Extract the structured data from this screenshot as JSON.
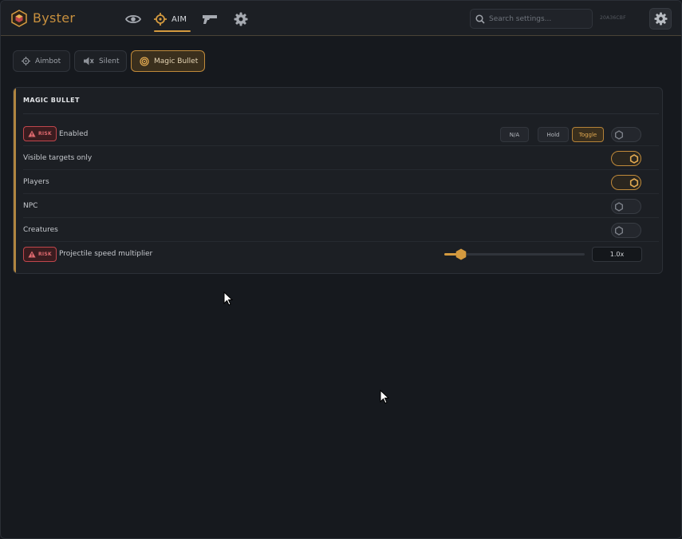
{
  "app": {
    "brand": "Byster",
    "hwid": "20A36CBF",
    "accent_color": "#d49a3f",
    "risk_color": "#c0464c"
  },
  "nav": {
    "items": [
      {
        "icon": "eye-icon",
        "label": ""
      },
      {
        "icon": "crosshair-icon",
        "label": "AIM",
        "active": true
      },
      {
        "icon": "gun-icon",
        "label": ""
      },
      {
        "icon": "gear-icon",
        "label": ""
      }
    ]
  },
  "search": {
    "placeholder": "Search settings...",
    "value": ""
  },
  "subtabs": [
    {
      "icon": "crosshair-icon",
      "label": "Aimbot",
      "active": false
    },
    {
      "icon": "mute-icon",
      "label": "Silent",
      "active": false
    },
    {
      "icon": "target-icon",
      "label": "Magic Bullet",
      "active": true
    }
  ],
  "panel": {
    "title": "MAGIC BULLET",
    "risk_label": "RISK",
    "rows": [
      {
        "label": "Enabled",
        "risk": true,
        "type": "toggle-keybind",
        "keybind": "N/A",
        "modes": [
          "Hold",
          "Toggle"
        ],
        "active_mode": "Toggle",
        "on": false
      },
      {
        "label": "Visible targets only",
        "risk": false,
        "type": "toggle",
        "on": true
      },
      {
        "label": "Players",
        "risk": false,
        "type": "toggle",
        "on": true
      },
      {
        "label": "NPC",
        "risk": false,
        "type": "toggle",
        "on": false
      },
      {
        "label": "Creatures",
        "risk": false,
        "type": "toggle",
        "on": false
      },
      {
        "label": "Projectile speed multiplier",
        "risk": true,
        "type": "slider",
        "value": "1.0x",
        "fraction": 0.12
      }
    ]
  }
}
